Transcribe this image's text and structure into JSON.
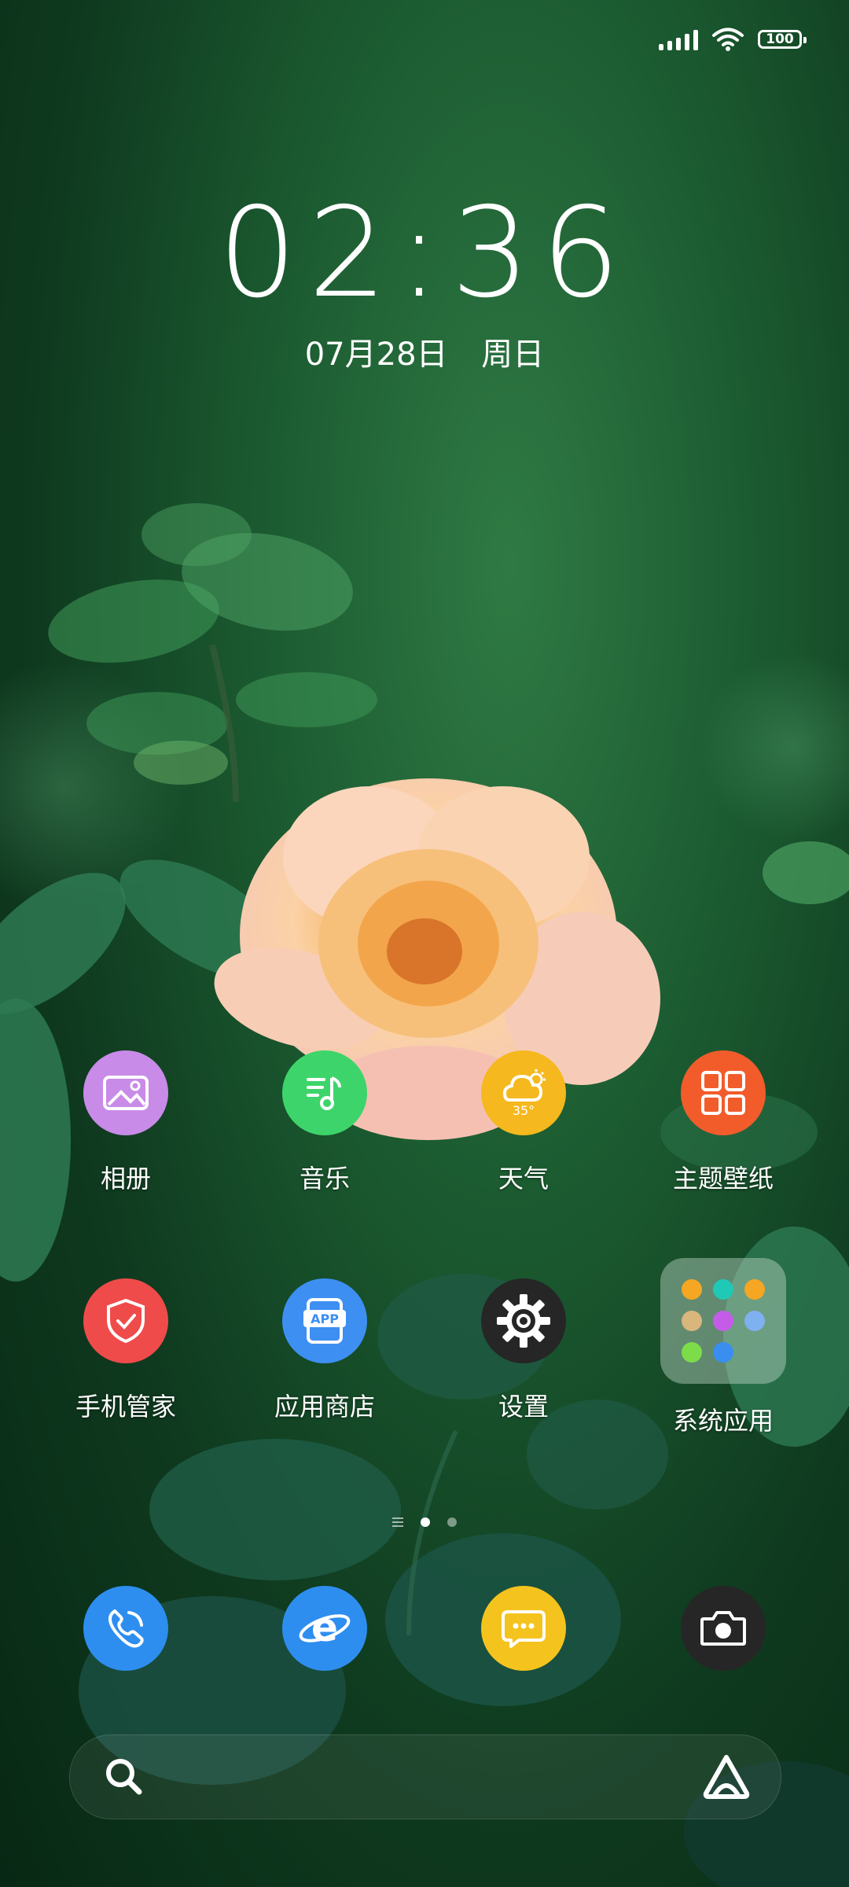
{
  "status": {
    "battery": "100"
  },
  "lockscreen": {
    "time": "02:36",
    "date": "07月28日 周日"
  },
  "apps": [
    {
      "id": "gallery",
      "label": "相册",
      "color": "#c88be8",
      "icon": "gallery-icon"
    },
    {
      "id": "music",
      "label": "音乐",
      "color": "#3dd56b",
      "icon": "music-icon"
    },
    {
      "id": "weather",
      "label": "天气",
      "color": "#f5b81e",
      "icon": "weather-icon",
      "badge": "35°"
    },
    {
      "id": "themes",
      "label": "主题壁纸",
      "color": "#f25c2b",
      "icon": "grid-icon"
    },
    {
      "id": "security",
      "label": "手机管家",
      "color": "#f04b4b",
      "icon": "shield-icon"
    },
    {
      "id": "appstore",
      "label": "应用商店",
      "color": "#3d8ff2",
      "icon": "app-store-icon",
      "badge": "APP"
    },
    {
      "id": "settings",
      "label": "设置",
      "color": "#2a2a2a",
      "icon": "gear-icon"
    },
    {
      "id": "sysapps",
      "label": "系统应用",
      "icon": "folder-icon"
    }
  ],
  "dock": [
    {
      "id": "phone",
      "color": "#2e8ef0",
      "icon": "phone-icon"
    },
    {
      "id": "browser",
      "color": "#2e8ef0",
      "icon": "browser-icon"
    },
    {
      "id": "messages",
      "color": "#f5c31e",
      "icon": "message-icon"
    },
    {
      "id": "camera",
      "color": "#2a2a2a",
      "icon": "camera-icon"
    }
  ]
}
